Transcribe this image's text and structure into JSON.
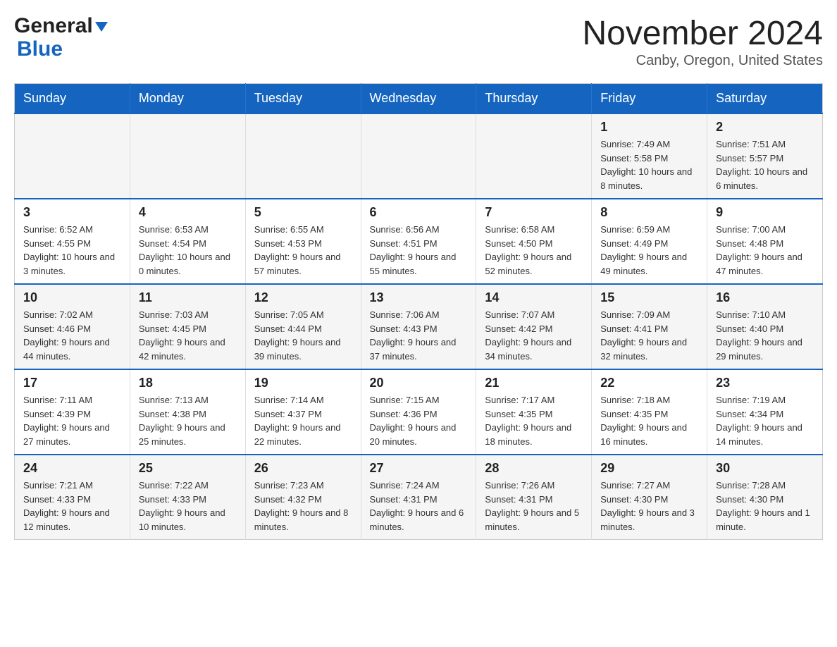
{
  "header": {
    "logo": {
      "text_general": "General",
      "text_blue": "Blue",
      "logo_aria": "GeneralBlue logo"
    },
    "title": "November 2024",
    "subtitle": "Canby, Oregon, United States"
  },
  "days_of_week": [
    "Sunday",
    "Monday",
    "Tuesday",
    "Wednesday",
    "Thursday",
    "Friday",
    "Saturday"
  ],
  "weeks": [
    {
      "days": [
        {
          "number": "",
          "sunrise": "",
          "sunset": "",
          "daylight": "",
          "empty": true
        },
        {
          "number": "",
          "sunrise": "",
          "sunset": "",
          "daylight": "",
          "empty": true
        },
        {
          "number": "",
          "sunrise": "",
          "sunset": "",
          "daylight": "",
          "empty": true
        },
        {
          "number": "",
          "sunrise": "",
          "sunset": "",
          "daylight": "",
          "empty": true
        },
        {
          "number": "",
          "sunrise": "",
          "sunset": "",
          "daylight": "",
          "empty": true
        },
        {
          "number": "1",
          "sunrise": "Sunrise: 7:49 AM",
          "sunset": "Sunset: 5:58 PM",
          "daylight": "Daylight: 10 hours and 8 minutes.",
          "empty": false
        },
        {
          "number": "2",
          "sunrise": "Sunrise: 7:51 AM",
          "sunset": "Sunset: 5:57 PM",
          "daylight": "Daylight: 10 hours and 6 minutes.",
          "empty": false
        }
      ]
    },
    {
      "days": [
        {
          "number": "3",
          "sunrise": "Sunrise: 6:52 AM",
          "sunset": "Sunset: 4:55 PM",
          "daylight": "Daylight: 10 hours and 3 minutes.",
          "empty": false
        },
        {
          "number": "4",
          "sunrise": "Sunrise: 6:53 AM",
          "sunset": "Sunset: 4:54 PM",
          "daylight": "Daylight: 10 hours and 0 minutes.",
          "empty": false
        },
        {
          "number": "5",
          "sunrise": "Sunrise: 6:55 AM",
          "sunset": "Sunset: 4:53 PM",
          "daylight": "Daylight: 9 hours and 57 minutes.",
          "empty": false
        },
        {
          "number": "6",
          "sunrise": "Sunrise: 6:56 AM",
          "sunset": "Sunset: 4:51 PM",
          "daylight": "Daylight: 9 hours and 55 minutes.",
          "empty": false
        },
        {
          "number": "7",
          "sunrise": "Sunrise: 6:58 AM",
          "sunset": "Sunset: 4:50 PM",
          "daylight": "Daylight: 9 hours and 52 minutes.",
          "empty": false
        },
        {
          "number": "8",
          "sunrise": "Sunrise: 6:59 AM",
          "sunset": "Sunset: 4:49 PM",
          "daylight": "Daylight: 9 hours and 49 minutes.",
          "empty": false
        },
        {
          "number": "9",
          "sunrise": "Sunrise: 7:00 AM",
          "sunset": "Sunset: 4:48 PM",
          "daylight": "Daylight: 9 hours and 47 minutes.",
          "empty": false
        }
      ]
    },
    {
      "days": [
        {
          "number": "10",
          "sunrise": "Sunrise: 7:02 AM",
          "sunset": "Sunset: 4:46 PM",
          "daylight": "Daylight: 9 hours and 44 minutes.",
          "empty": false
        },
        {
          "number": "11",
          "sunrise": "Sunrise: 7:03 AM",
          "sunset": "Sunset: 4:45 PM",
          "daylight": "Daylight: 9 hours and 42 minutes.",
          "empty": false
        },
        {
          "number": "12",
          "sunrise": "Sunrise: 7:05 AM",
          "sunset": "Sunset: 4:44 PM",
          "daylight": "Daylight: 9 hours and 39 minutes.",
          "empty": false
        },
        {
          "number": "13",
          "sunrise": "Sunrise: 7:06 AM",
          "sunset": "Sunset: 4:43 PM",
          "daylight": "Daylight: 9 hours and 37 minutes.",
          "empty": false
        },
        {
          "number": "14",
          "sunrise": "Sunrise: 7:07 AM",
          "sunset": "Sunset: 4:42 PM",
          "daylight": "Daylight: 9 hours and 34 minutes.",
          "empty": false
        },
        {
          "number": "15",
          "sunrise": "Sunrise: 7:09 AM",
          "sunset": "Sunset: 4:41 PM",
          "daylight": "Daylight: 9 hours and 32 minutes.",
          "empty": false
        },
        {
          "number": "16",
          "sunrise": "Sunrise: 7:10 AM",
          "sunset": "Sunset: 4:40 PM",
          "daylight": "Daylight: 9 hours and 29 minutes.",
          "empty": false
        }
      ]
    },
    {
      "days": [
        {
          "number": "17",
          "sunrise": "Sunrise: 7:11 AM",
          "sunset": "Sunset: 4:39 PM",
          "daylight": "Daylight: 9 hours and 27 minutes.",
          "empty": false
        },
        {
          "number": "18",
          "sunrise": "Sunrise: 7:13 AM",
          "sunset": "Sunset: 4:38 PM",
          "daylight": "Daylight: 9 hours and 25 minutes.",
          "empty": false
        },
        {
          "number": "19",
          "sunrise": "Sunrise: 7:14 AM",
          "sunset": "Sunset: 4:37 PM",
          "daylight": "Daylight: 9 hours and 22 minutes.",
          "empty": false
        },
        {
          "number": "20",
          "sunrise": "Sunrise: 7:15 AM",
          "sunset": "Sunset: 4:36 PM",
          "daylight": "Daylight: 9 hours and 20 minutes.",
          "empty": false
        },
        {
          "number": "21",
          "sunrise": "Sunrise: 7:17 AM",
          "sunset": "Sunset: 4:35 PM",
          "daylight": "Daylight: 9 hours and 18 minutes.",
          "empty": false
        },
        {
          "number": "22",
          "sunrise": "Sunrise: 7:18 AM",
          "sunset": "Sunset: 4:35 PM",
          "daylight": "Daylight: 9 hours and 16 minutes.",
          "empty": false
        },
        {
          "number": "23",
          "sunrise": "Sunrise: 7:19 AM",
          "sunset": "Sunset: 4:34 PM",
          "daylight": "Daylight: 9 hours and 14 minutes.",
          "empty": false
        }
      ]
    },
    {
      "days": [
        {
          "number": "24",
          "sunrise": "Sunrise: 7:21 AM",
          "sunset": "Sunset: 4:33 PM",
          "daylight": "Daylight: 9 hours and 12 minutes.",
          "empty": false
        },
        {
          "number": "25",
          "sunrise": "Sunrise: 7:22 AM",
          "sunset": "Sunset: 4:33 PM",
          "daylight": "Daylight: 9 hours and 10 minutes.",
          "empty": false
        },
        {
          "number": "26",
          "sunrise": "Sunrise: 7:23 AM",
          "sunset": "Sunset: 4:32 PM",
          "daylight": "Daylight: 9 hours and 8 minutes.",
          "empty": false
        },
        {
          "number": "27",
          "sunrise": "Sunrise: 7:24 AM",
          "sunset": "Sunset: 4:31 PM",
          "daylight": "Daylight: 9 hours and 6 minutes.",
          "empty": false
        },
        {
          "number": "28",
          "sunrise": "Sunrise: 7:26 AM",
          "sunset": "Sunset: 4:31 PM",
          "daylight": "Daylight: 9 hours and 5 minutes.",
          "empty": false
        },
        {
          "number": "29",
          "sunrise": "Sunrise: 7:27 AM",
          "sunset": "Sunset: 4:30 PM",
          "daylight": "Daylight: 9 hours and 3 minutes.",
          "empty": false
        },
        {
          "number": "30",
          "sunrise": "Sunrise: 7:28 AM",
          "sunset": "Sunset: 4:30 PM",
          "daylight": "Daylight: 9 hours and 1 minute.",
          "empty": false
        }
      ]
    }
  ]
}
